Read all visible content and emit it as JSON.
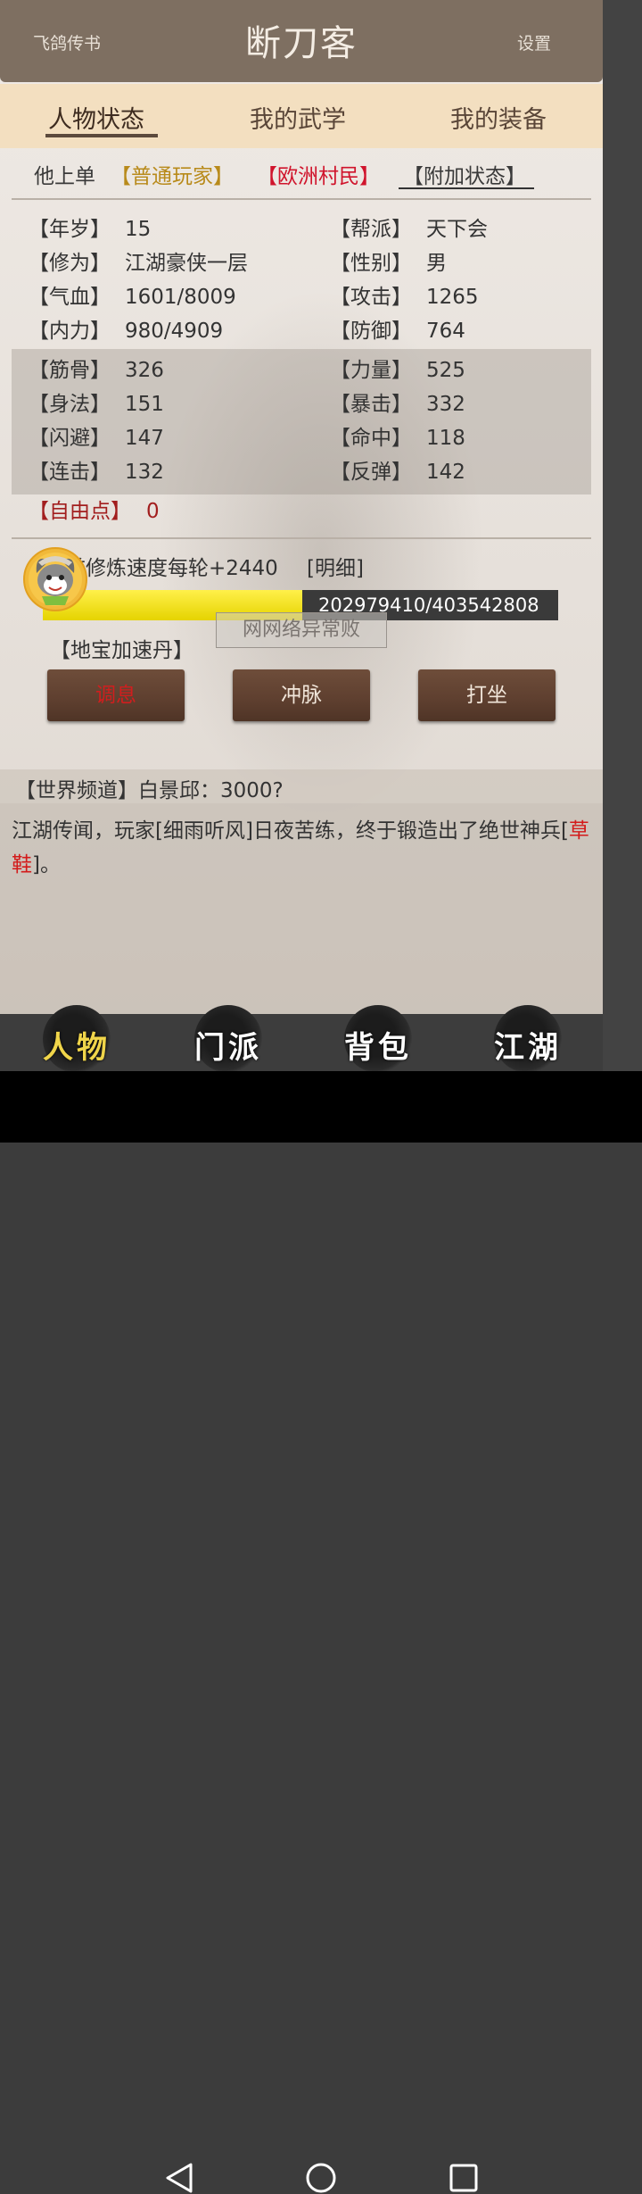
{
  "header": {
    "left_label": "飞鸽传书",
    "title": "断刀客",
    "right_label": "设置"
  },
  "tabs": [
    {
      "label": "人物状态"
    },
    {
      "label": "我的武学"
    },
    {
      "label": "我的装备"
    }
  ],
  "subtabs": {
    "player_name": "他上单",
    "tag_normal": "【普通玩家】",
    "tag_region": "【欧洲村民】",
    "tag_extra": "【附加状态】"
  },
  "stats_left": [
    {
      "label": "【年岁】",
      "value": "15"
    },
    {
      "label": "【修为】",
      "value": "江湖豪侠一层"
    },
    {
      "label": "【气血】",
      "value": "1601/8009"
    },
    {
      "label": "【内力】",
      "value": "980/4909"
    }
  ],
  "stats_right": [
    {
      "label": "【帮派】",
      "value": "天下会"
    },
    {
      "label": "【性别】",
      "value": "男"
    },
    {
      "label": "【攻击】",
      "value": "1265"
    },
    {
      "label": "【防御】",
      "value": "764"
    }
  ],
  "attrs_left": [
    {
      "label": "【筋骨】",
      "value": "326"
    },
    {
      "label": "【身法】",
      "value": "151"
    },
    {
      "label": "【闪避】",
      "value": "147"
    },
    {
      "label": "【连击】",
      "value": "132"
    }
  ],
  "attrs_right": [
    {
      "label": "【力量】",
      "value": "525"
    },
    {
      "label": "【暴击】",
      "value": "332"
    },
    {
      "label": "【命中】",
      "value": "118"
    },
    {
      "label": "【反弹】",
      "value": "142"
    }
  ],
  "free_points": {
    "label": "【自由点】",
    "value": "0"
  },
  "cultivation": {
    "text": "当前修炼速度每轮+2440",
    "detail_link": "[明细]",
    "progress_text": "202979410/403542808",
    "progress_fraction": 0.503
  },
  "toast": "网网络异常败",
  "item_label": "【地宝加速丹】",
  "buttons": {
    "rest": "调息",
    "meridian": "冲脉",
    "meditate": "打坐"
  },
  "chat": {
    "world_line": "【世界频道】白景邱：3000?",
    "message_pre": "江湖传闻，玩家[细雨听风]日夜苦练，终于锻造出了绝世神兵[",
    "message_item": "草鞋",
    "message_post": "]。"
  },
  "bottom_nav": [
    {
      "label": "人物"
    },
    {
      "label": "门派"
    },
    {
      "label": "背包"
    },
    {
      "label": "江湖"
    }
  ],
  "colors": {
    "header_bg": "#7e6f61",
    "tab_bg": "#f3dfc0",
    "accent_red": "#d0142c",
    "accent_gold": "#b88a1a",
    "button_bg": "#5e3f2f",
    "progress_fill": "#e5d300"
  }
}
